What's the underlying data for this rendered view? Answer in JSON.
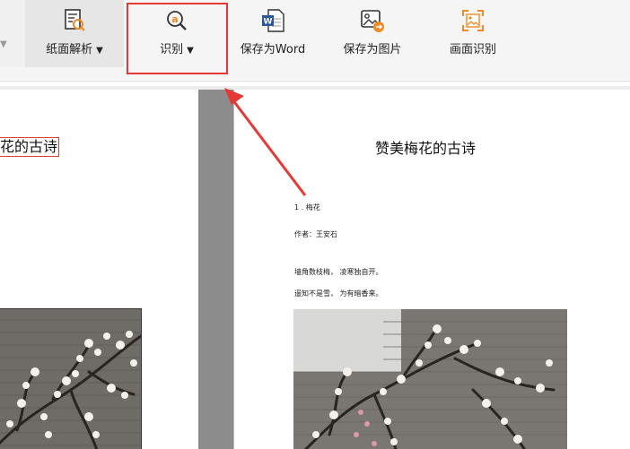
{
  "toolbar": {
    "paper_parse_label": "纸面解析",
    "recognize_label": "识别",
    "save_word_label": "保存为Word",
    "save_image_label": "保存为图片",
    "screen_recognize_label": "画面识别",
    "dropdown_glyph": "▼",
    "left_stub_glyph": "▼"
  },
  "left_page": {
    "title_fragment": "花的古诗"
  },
  "right_page": {
    "title": "赞美梅花的古诗",
    "lines": [
      "1 . 梅花",
      "作者：王安石",
      "墙角数枝梅，  凌寒独自开。",
      "遥知不是雪，  为有暗香来。"
    ]
  },
  "colors": {
    "highlight": "#e53935",
    "accent_orange": "#f08a24",
    "word_blue": "#2b5797"
  }
}
